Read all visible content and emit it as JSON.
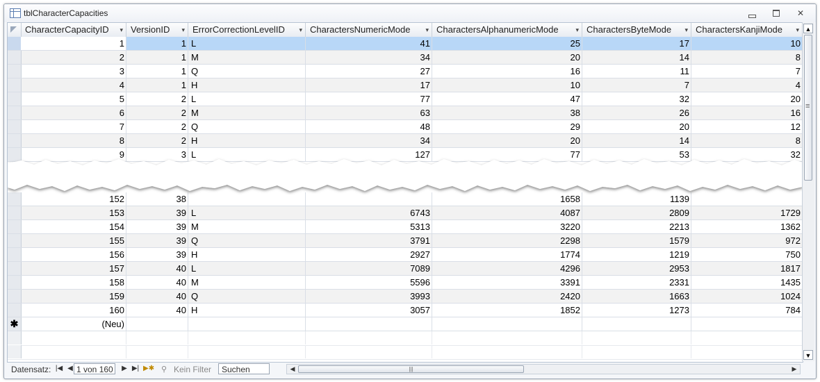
{
  "window": {
    "title": "tblCharacterCapacities"
  },
  "columns": [
    {
      "label": "CharacterCapacityID",
      "width": 152
    },
    {
      "label": "VersionID",
      "width": 89
    },
    {
      "label": "ErrorCorrectionLevelID",
      "width": 169
    },
    {
      "label": "CharactersNumericMode",
      "width": 182
    },
    {
      "label": "CharactersAlphanumericMode",
      "width": 216
    },
    {
      "label": "CharactersByteMode",
      "width": 157
    },
    {
      "label": "CharactersKanjiMode",
      "width": 160
    }
  ],
  "top_rows": [
    [
      "1",
      "1",
      "L",
      "41",
      "25",
      "17",
      "10"
    ],
    [
      "2",
      "1",
      "M",
      "34",
      "20",
      "14",
      "8"
    ],
    [
      "3",
      "1",
      "Q",
      "27",
      "16",
      "11",
      "7"
    ],
    [
      "4",
      "1",
      "H",
      "17",
      "10",
      "7",
      "4"
    ],
    [
      "5",
      "2",
      "L",
      "77",
      "47",
      "32",
      "20"
    ],
    [
      "6",
      "2",
      "M",
      "63",
      "38",
      "26",
      "16"
    ],
    [
      "7",
      "2",
      "Q",
      "48",
      "29",
      "20",
      "12"
    ],
    [
      "8",
      "2",
      "H",
      "34",
      "20",
      "14",
      "8"
    ],
    [
      "9",
      "3",
      "L",
      "127",
      "77",
      "53",
      "32"
    ]
  ],
  "bottom_rows": [
    [
      "152",
      "38",
      "",
      "",
      "1658",
      "1139",
      ""
    ],
    [
      "153",
      "39",
      "L",
      "6743",
      "4087",
      "2809",
      "1729"
    ],
    [
      "154",
      "39",
      "M",
      "5313",
      "3220",
      "2213",
      "1362"
    ],
    [
      "155",
      "39",
      "Q",
      "3791",
      "2298",
      "1579",
      "972"
    ],
    [
      "156",
      "39",
      "H",
      "2927",
      "1774",
      "1219",
      "750"
    ],
    [
      "157",
      "40",
      "L",
      "7089",
      "4296",
      "2953",
      "1817"
    ],
    [
      "158",
      "40",
      "M",
      "5596",
      "3391",
      "2331",
      "1435"
    ],
    [
      "159",
      "40",
      "Q",
      "3993",
      "2420",
      "1663",
      "1024"
    ],
    [
      "160",
      "40",
      "H",
      "3057",
      "1852",
      "1273",
      "784"
    ]
  ],
  "new_row": {
    "marker": "✱",
    "label": "(Neu)"
  },
  "nav": {
    "label": "Datensatz:",
    "record": "1 von 160",
    "filter": "Kein Filter",
    "search": "Suchen"
  }
}
